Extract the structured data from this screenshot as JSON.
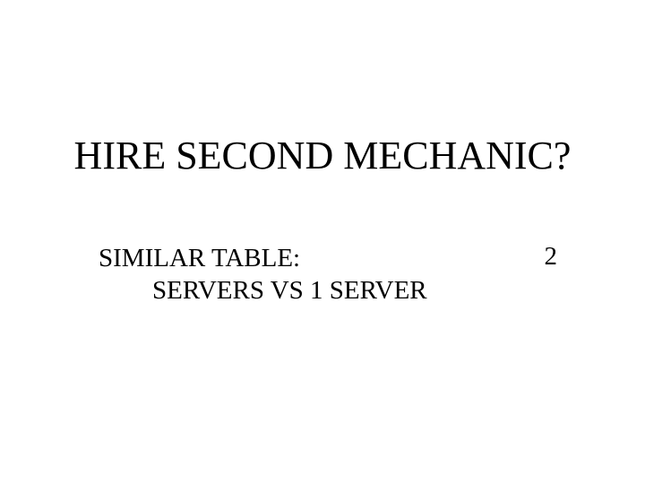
{
  "slide": {
    "title": "HIRE SECOND MECHANIC?",
    "body_line1": "SIMILAR TABLE:",
    "body_line2": "SERVERS VS 1 SERVER",
    "page_number": "2"
  }
}
